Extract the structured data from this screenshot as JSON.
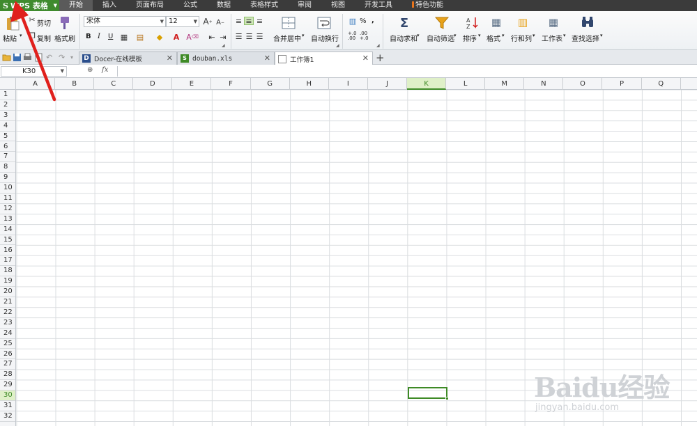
{
  "app": {
    "name": "WPS 表格",
    "logo": "S"
  },
  "menu": {
    "items": [
      "开始",
      "插入",
      "页面布局",
      "公式",
      "数据",
      "表格样式",
      "审阅",
      "视图",
      "开发工具",
      "特色功能"
    ],
    "active_index": 0
  },
  "ribbon": {
    "paste": "粘贴",
    "cut": "剪切",
    "copy": "复制",
    "format_painter": "格式刷",
    "font_name": "宋体",
    "font_size": "12",
    "bold": "B",
    "italic": "I",
    "underline": "U",
    "merge_center": "合并居中",
    "wrap_text": "自动换行",
    "percent": "%",
    "autosum": "自动求和",
    "autofilter": "自动筛选",
    "sort": "排序",
    "format": "格式",
    "row_col": "行和列",
    "worksheet": "工作表",
    "find_select": "查找选择"
  },
  "tabs": [
    {
      "label": "Docer-在线模板",
      "active": false
    },
    {
      "label": "douban.xls",
      "active": false
    },
    {
      "label": "工作簿1",
      "active": true
    }
  ],
  "formula_bar": {
    "name_box": "K30",
    "fx": "fx",
    "formula": ""
  },
  "grid": {
    "columns": [
      "A",
      "B",
      "C",
      "D",
      "E",
      "F",
      "G",
      "H",
      "I",
      "J",
      "K",
      "L",
      "M",
      "N",
      "O",
      "P",
      "Q"
    ],
    "rows": [
      "1",
      "2",
      "3",
      "4",
      "5",
      "6",
      "7",
      "8",
      "9",
      "10",
      "11",
      "12",
      "13",
      "14",
      "15",
      "16",
      "17",
      "18",
      "19",
      "20",
      "21",
      "22",
      "23",
      "24",
      "25",
      "26",
      "27",
      "28",
      "29",
      "30",
      "31",
      "32"
    ],
    "selected_column": "K",
    "selected_row": "30"
  },
  "watermark": {
    "main": "Baidu经验",
    "sub": "jingyan.baidu.com"
  },
  "colors": {
    "accent": "#3f8b2e",
    "menubar": "#3b3b3b",
    "arrow": "#e0201c"
  }
}
